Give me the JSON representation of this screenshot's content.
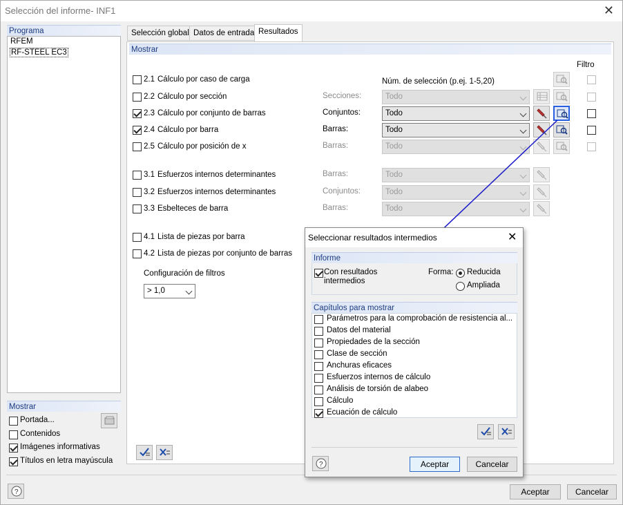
{
  "window": {
    "title": "Selección del informe- INF1"
  },
  "program_panel": {
    "header": "Programa",
    "items": [
      "RFEM",
      "RF-STEEL EC3"
    ]
  },
  "show_panel": {
    "header": "Mostrar",
    "items": [
      {
        "label": "Portada...",
        "checked": false
      },
      {
        "label": "Contenidos",
        "checked": false
      },
      {
        "label": "Imágenes informativas",
        "checked": true
      },
      {
        "label": "Títulos en letra mayúscula",
        "checked": true
      }
    ]
  },
  "tabs": [
    "Selección global",
    "Datos de entrada",
    "Resultados"
  ],
  "active_tab": "Resultados",
  "results": {
    "header": "Mostrar",
    "filter_label": "Filtro",
    "selection_hint": "Núm. de selección (p.ej. 1-5,20)",
    "rows": [
      {
        "num": "2.1",
        "label": "Cálculo por caso de carga",
        "checked": false,
        "field": "",
        "value": ""
      },
      {
        "num": "2.2",
        "label": "Cálculo por sección",
        "checked": false,
        "field": "Secciones:",
        "value": "Todo"
      },
      {
        "num": "2.3",
        "label": "Cálculo por conjunto de barras",
        "checked": true,
        "field": "Conjuntos:",
        "value": "Todo"
      },
      {
        "num": "2.4",
        "label": "Cálculo por barra",
        "checked": true,
        "field": "Barras:",
        "value": "Todo"
      },
      {
        "num": "2.5",
        "label": "Cálculo por posición de x",
        "checked": false,
        "field": "Barras:",
        "value": "Todo"
      },
      {
        "num": "3.1",
        "label": "Esfuerzos internos determinantes",
        "checked": false,
        "field": "Barras:",
        "value": "Todo"
      },
      {
        "num": "3.2",
        "label": "Esfuerzos internos determinantes",
        "checked": false,
        "field": "Conjuntos:",
        "value": "Todo"
      },
      {
        "num": "3.3",
        "label": "Esbelteces de barra",
        "checked": false,
        "field": "Barras:",
        "value": "Todo"
      },
      {
        "num": "4.1",
        "label": "Lista de piezas por barra",
        "checked": false,
        "field": "",
        "value": ""
      },
      {
        "num": "4.2",
        "label": "Lista de piezas por conjunto de barras",
        "checked": false,
        "field": "",
        "value": ""
      }
    ],
    "filter_config_label": "Configuración de filtros",
    "filter_config_value": "> 1,0"
  },
  "main_buttons": {
    "accept": "Aceptar",
    "cancel": "Cancelar"
  },
  "dialog": {
    "title": "Seleccionar resultados intermedios",
    "informe_header": "Informe",
    "intermediate_line1": "Con resultados",
    "intermediate_line2": "intermedios",
    "intermediate_checked": true,
    "forma_label": "Forma:",
    "forma_options": [
      {
        "label": "Reducida",
        "selected": true
      },
      {
        "label": "Ampliada",
        "selected": false
      }
    ],
    "chapters_header": "Capítulos para mostrar",
    "chapters": [
      {
        "label": "Parámetros para la comprobación de resistencia al...",
        "checked": false
      },
      {
        "label": "Datos del material",
        "checked": false
      },
      {
        "label": "Propiedades de la sección",
        "checked": false
      },
      {
        "label": "Clase de sección",
        "checked": false
      },
      {
        "label": "Anchuras eficaces",
        "checked": false
      },
      {
        "label": "Esfuerzos internos de cálculo",
        "checked": false
      },
      {
        "label": "Análisis de torsión de alabeo",
        "checked": false
      },
      {
        "label": "Cálculo",
        "checked": false
      },
      {
        "label": "Ecuación de cálculo",
        "checked": true
      }
    ],
    "accept": "Aceptar",
    "cancel": "Cancelar"
  }
}
